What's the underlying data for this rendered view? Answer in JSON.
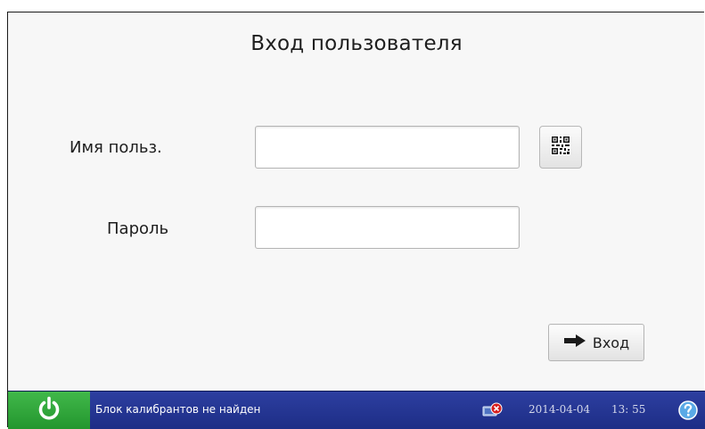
{
  "login": {
    "title": "Вход пользователя",
    "username_label": "Имя польз.",
    "username_value": "",
    "password_label": "Пароль",
    "password_value": "",
    "submit_label": "Вход",
    "qr_icon": "qr-code-icon",
    "submit_icon": "arrow-right-icon"
  },
  "statusbar": {
    "power_icon": "power-icon",
    "message": "Блок калибрантов не найден",
    "network_icon": "network-disconnected-icon",
    "date": "2014-04-04",
    "time": "13: 55",
    "help_icon": "help-icon"
  },
  "colors": {
    "statusbar": "#233494",
    "power": "#2fa83a",
    "help": "#5aa9e6",
    "alert": "#d61e1e"
  }
}
